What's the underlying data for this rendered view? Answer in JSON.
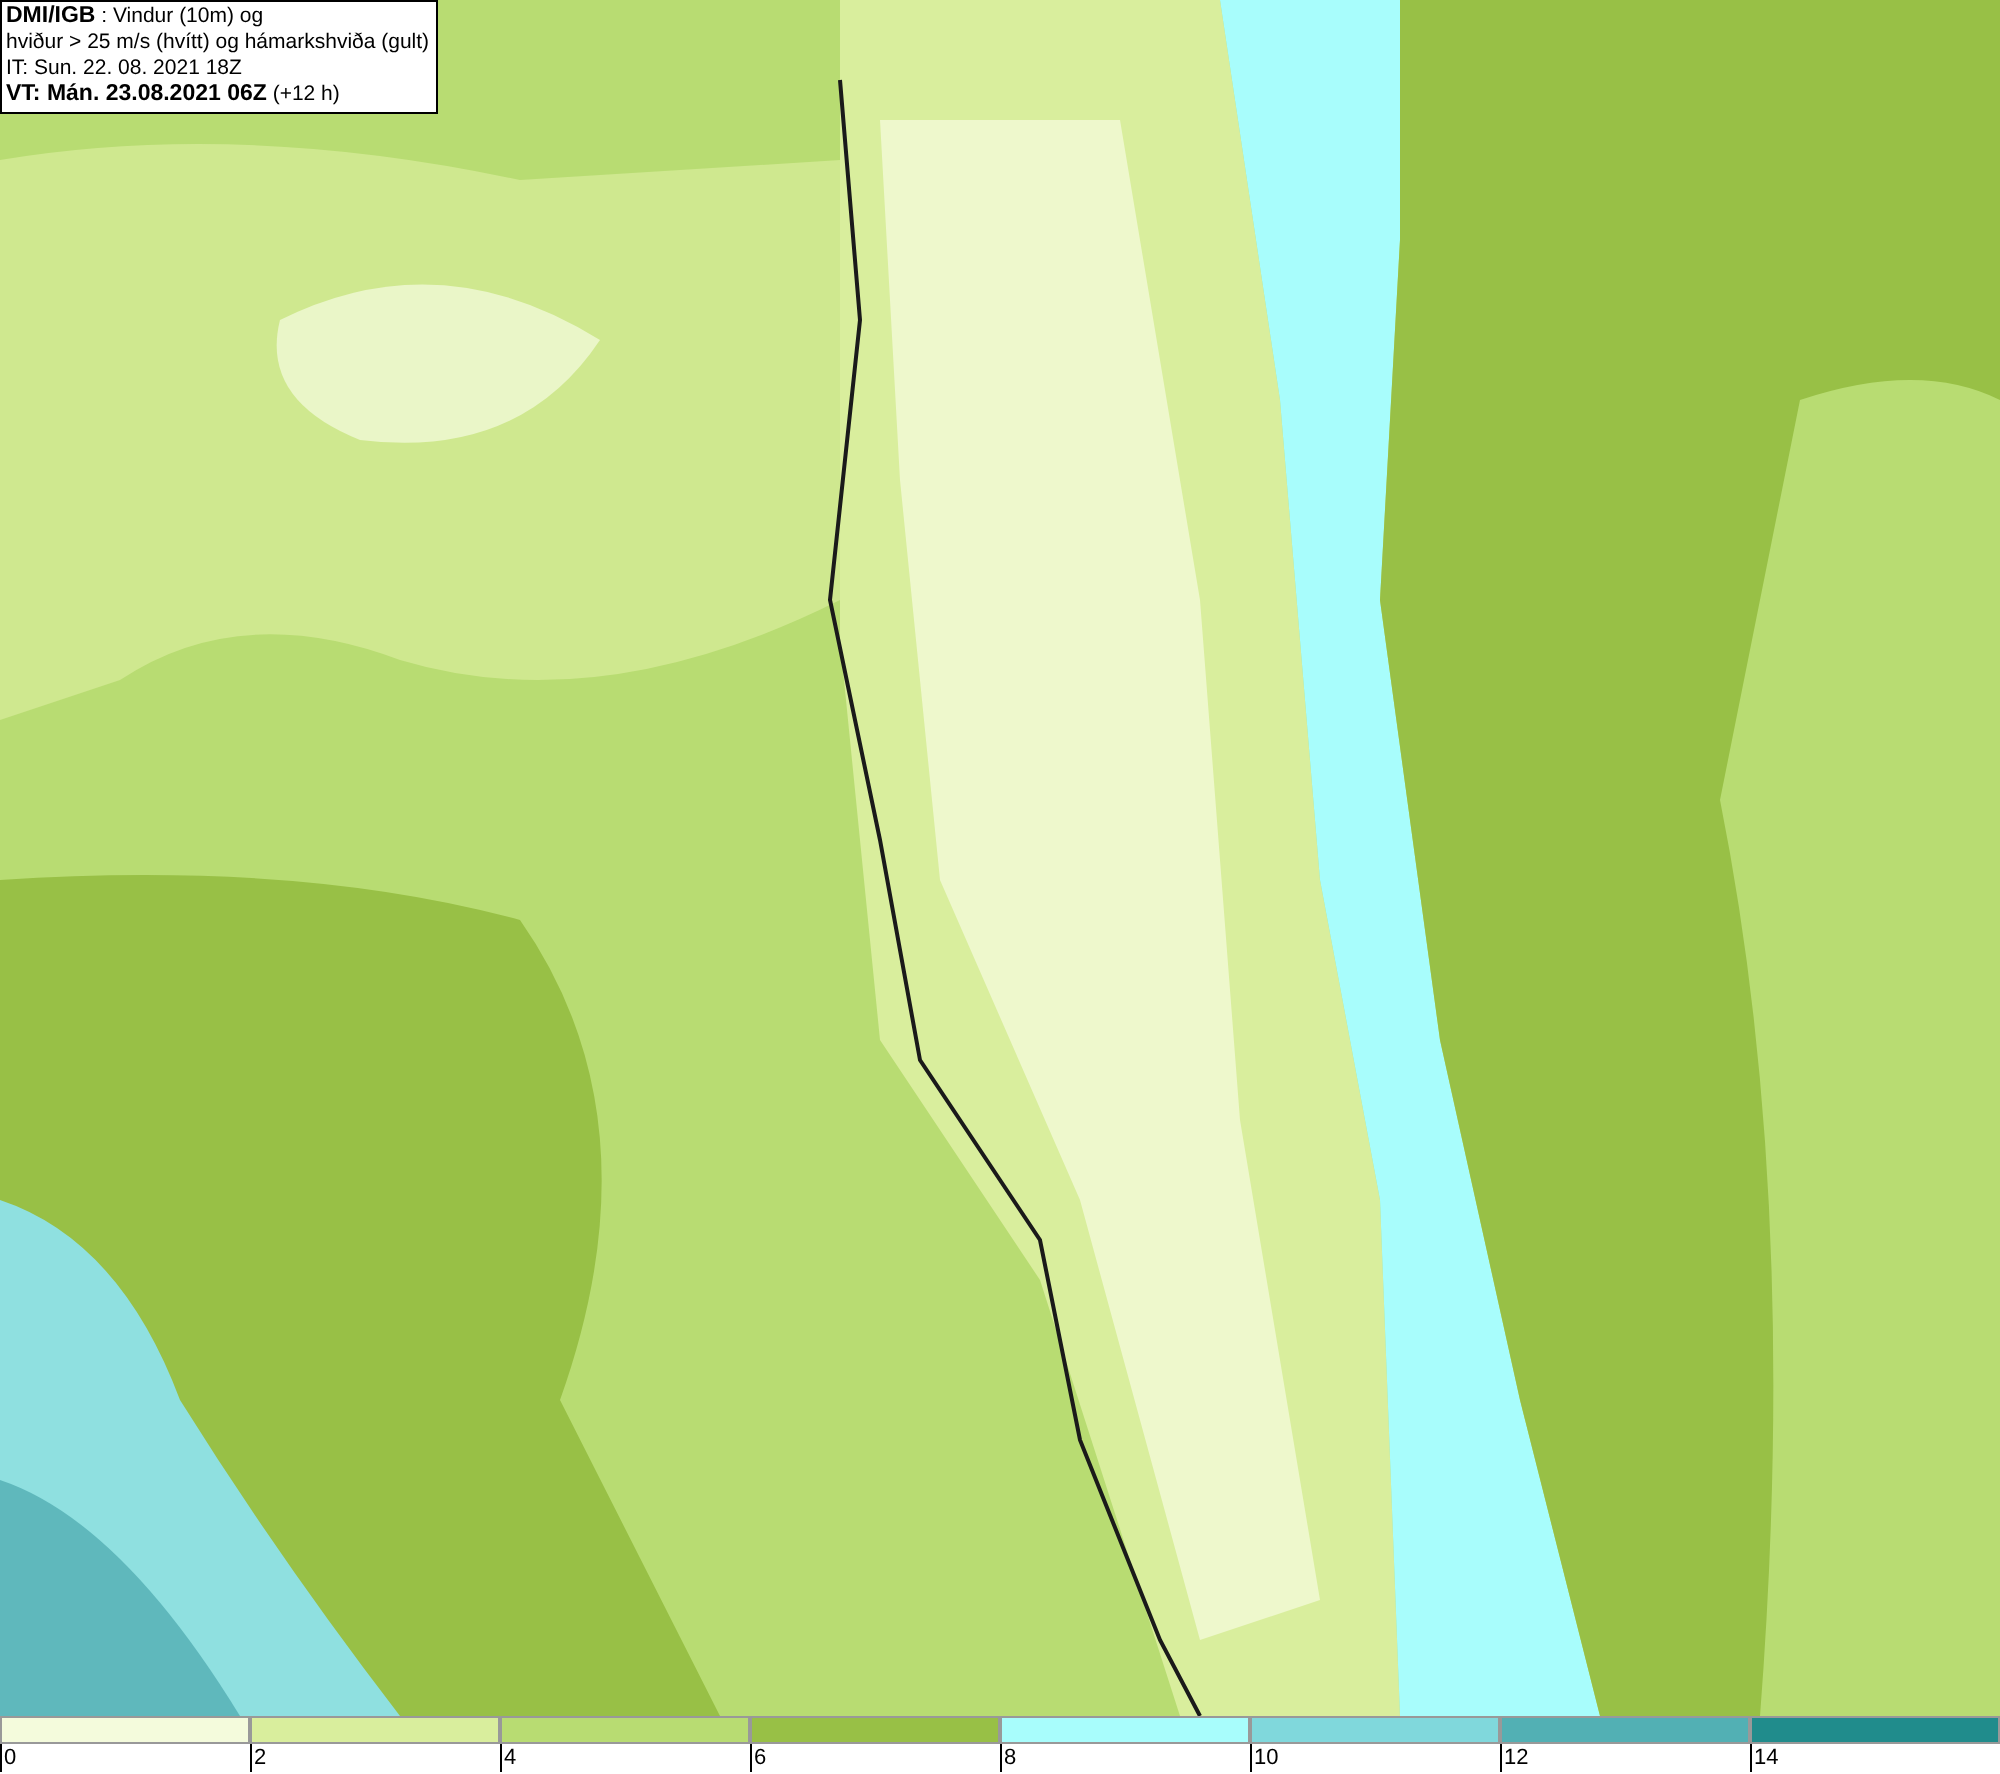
{
  "title_box": {
    "lines": [
      "**DMI/IGB** : Vindur (10m) og",
      "hviður > 25 m/s (hvítt) og hámarkshviða (gult)",
      "IT: Sun. 22. 08. 2021 18Z",
      "**VT: Mán. 23.08.2021 06Z** (+12 h)"
    ]
  },
  "legend": [
    {
      "label": "0",
      "color": "#f4fbdc"
    },
    {
      "label": "2",
      "color": "#d9ee9d"
    },
    {
      "label": "4",
      "color": "#b8dc72"
    },
    {
      "label": "6",
      "color": "#98c046"
    },
    {
      "label": "8",
      "color": "#a8fdfc"
    },
    {
      "label": "10",
      "color": "#80d8dc"
    },
    {
      "label": "12",
      "color": "#52b0b4"
    },
    {
      "label": "14",
      "color": "#208c8c"
    }
  ]
}
